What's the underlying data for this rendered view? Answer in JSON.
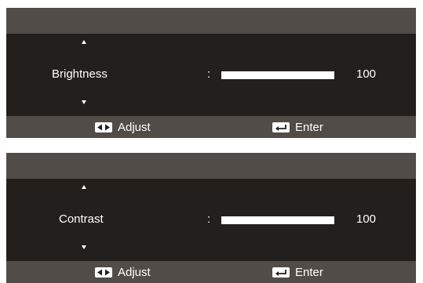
{
  "panels": [
    {
      "label": "Brightness",
      "separator": ":",
      "value": "100",
      "level_percent": 100
    },
    {
      "label": "Contrast",
      "separator": ":",
      "value": "100",
      "level_percent": 100
    }
  ],
  "footer": {
    "adjust_label": "Adjust",
    "enter_label": "Enter",
    "adjust_icon": "left-right-arrows-icon",
    "enter_icon": "enter-return-icon"
  },
  "colors": {
    "header_footer_bg": "#514c48",
    "body_bg": "#231f1c",
    "text": "#ffffff"
  }
}
